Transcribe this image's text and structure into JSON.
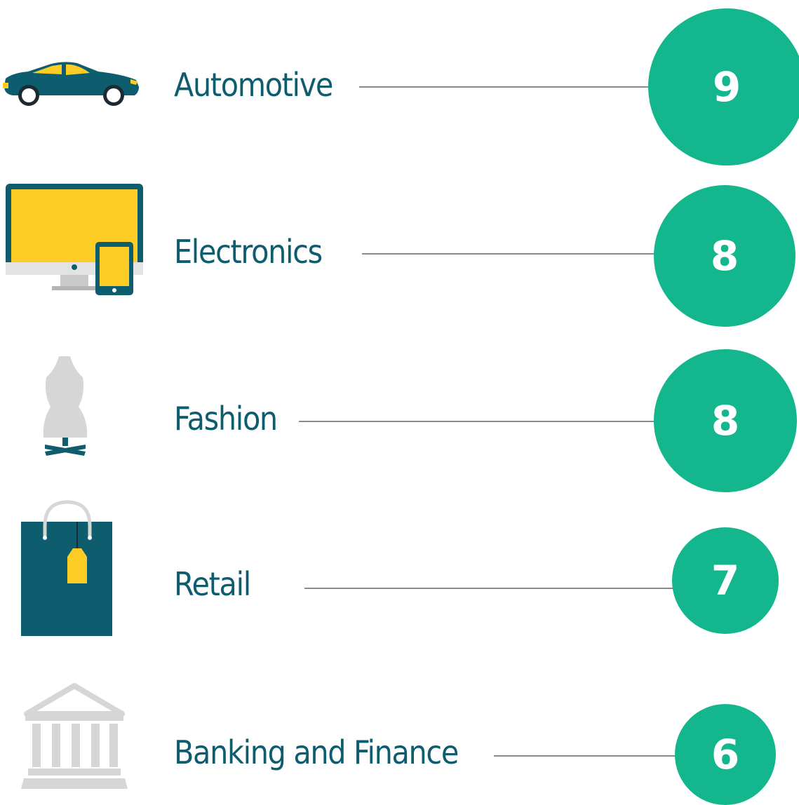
{
  "colors": {
    "label": "#0d5d6e",
    "circle": "#13b68d",
    "value_text": "#ffffff",
    "leader_line": "#8a8a8a",
    "icon_teal": "#0d5d6e",
    "icon_yellow": "#fdcd26",
    "icon_gray": "#d6d6d6"
  },
  "chart_data": {
    "type": "bar",
    "categories": [
      "Automotive",
      "Electronics",
      "Fashion",
      "Retail",
      "Banking and Finance"
    ],
    "values": [
      9,
      8,
      8,
      7,
      6
    ],
    "value_labels": [
      "9",
      "8",
      "8",
      "7",
      "6"
    ],
    "icons": [
      "car-icon",
      "computer-tablet-icon",
      "dress-form-icon",
      "shopping-bag-icon",
      "bank-building-icon"
    ]
  }
}
